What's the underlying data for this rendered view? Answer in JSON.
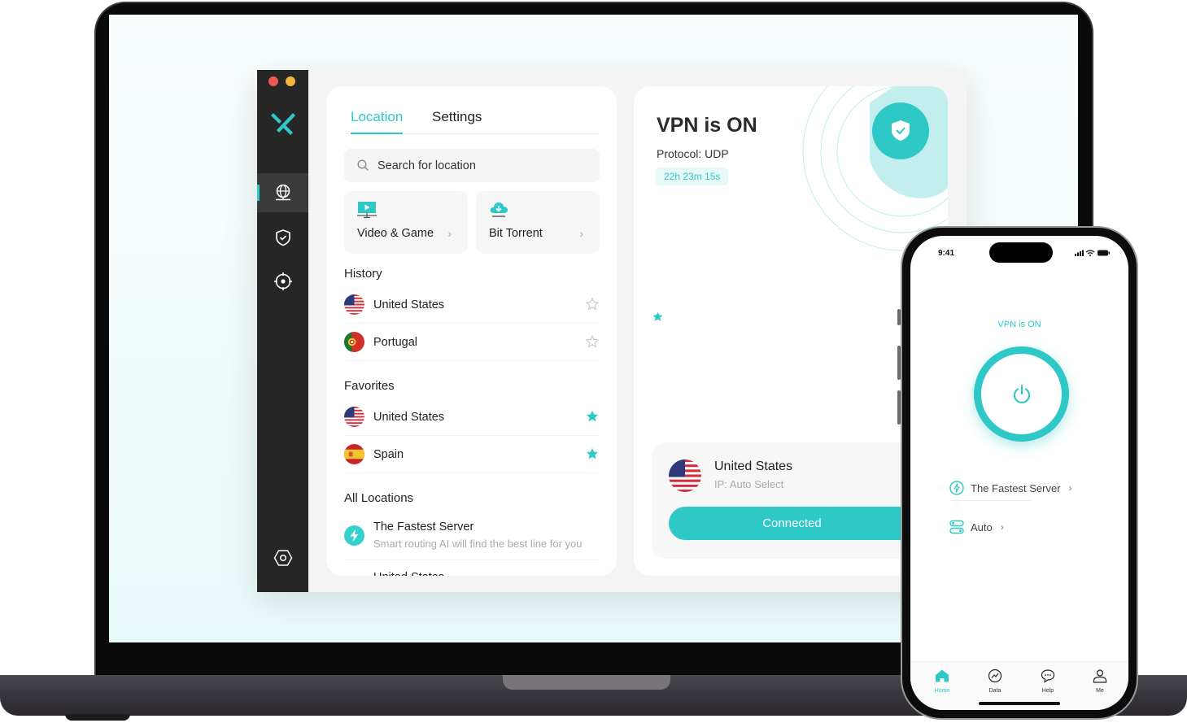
{
  "colors": {
    "accent": "#2ec9c7",
    "rail_bg": "#262626",
    "traffic_red": "#ee5a52",
    "traffic_yellow": "#f4b73e"
  },
  "desktop_app": {
    "rail": {
      "items": [
        {
          "icon": "globe-icon",
          "active": true
        },
        {
          "icon": "shield-check-icon",
          "active": false
        },
        {
          "icon": "crosshair-icon",
          "active": false
        },
        {
          "icon": "settings-hexagon-icon",
          "active": false
        }
      ]
    },
    "tabs": [
      {
        "label": "Location",
        "active": true
      },
      {
        "label": "Settings",
        "active": false
      }
    ],
    "search": {
      "placeholder": "Search for location"
    },
    "tiles": [
      {
        "label": "Video & Game",
        "icon": "monitor-play-icon"
      },
      {
        "label": "Bit Torrent",
        "icon": "cloud-download-icon"
      }
    ],
    "history": {
      "title": "History",
      "items": [
        {
          "name": "United States",
          "favorite": false
        },
        {
          "name": "Portugal",
          "favorite": false
        }
      ]
    },
    "favorites": {
      "title": "Favorites",
      "items": [
        {
          "name": "United States",
          "favorite": true
        },
        {
          "name": "Spain",
          "favorite": true
        }
      ]
    },
    "all_locations": {
      "title": "All Locations",
      "fastest": {
        "title": "The Fastest Server",
        "subtitle": "Smart routing AI will find the best line for you"
      },
      "next_item": "United States"
    },
    "status": {
      "title": "VPN is ON",
      "protocol": "Protocol: UDP",
      "duration": "22h 23m 15s"
    },
    "connection": {
      "country": "United States",
      "ip": "IP: Auto Select",
      "button": "Connected"
    }
  },
  "phone_app": {
    "time": "9:41",
    "status": "VPN is ON",
    "rows": [
      {
        "label": "The Fastest Server",
        "icon": "lightning-icon"
      },
      {
        "label": "Auto",
        "icon": "toggle-icon"
      }
    ],
    "tabbar": [
      {
        "label": "Home",
        "icon": "home-icon",
        "active": true
      },
      {
        "label": "Data",
        "icon": "data-chart-icon",
        "active": false
      },
      {
        "label": "Help",
        "icon": "chat-bubble-icon",
        "active": false
      },
      {
        "label": "Me",
        "icon": "user-icon",
        "active": false
      }
    ]
  }
}
